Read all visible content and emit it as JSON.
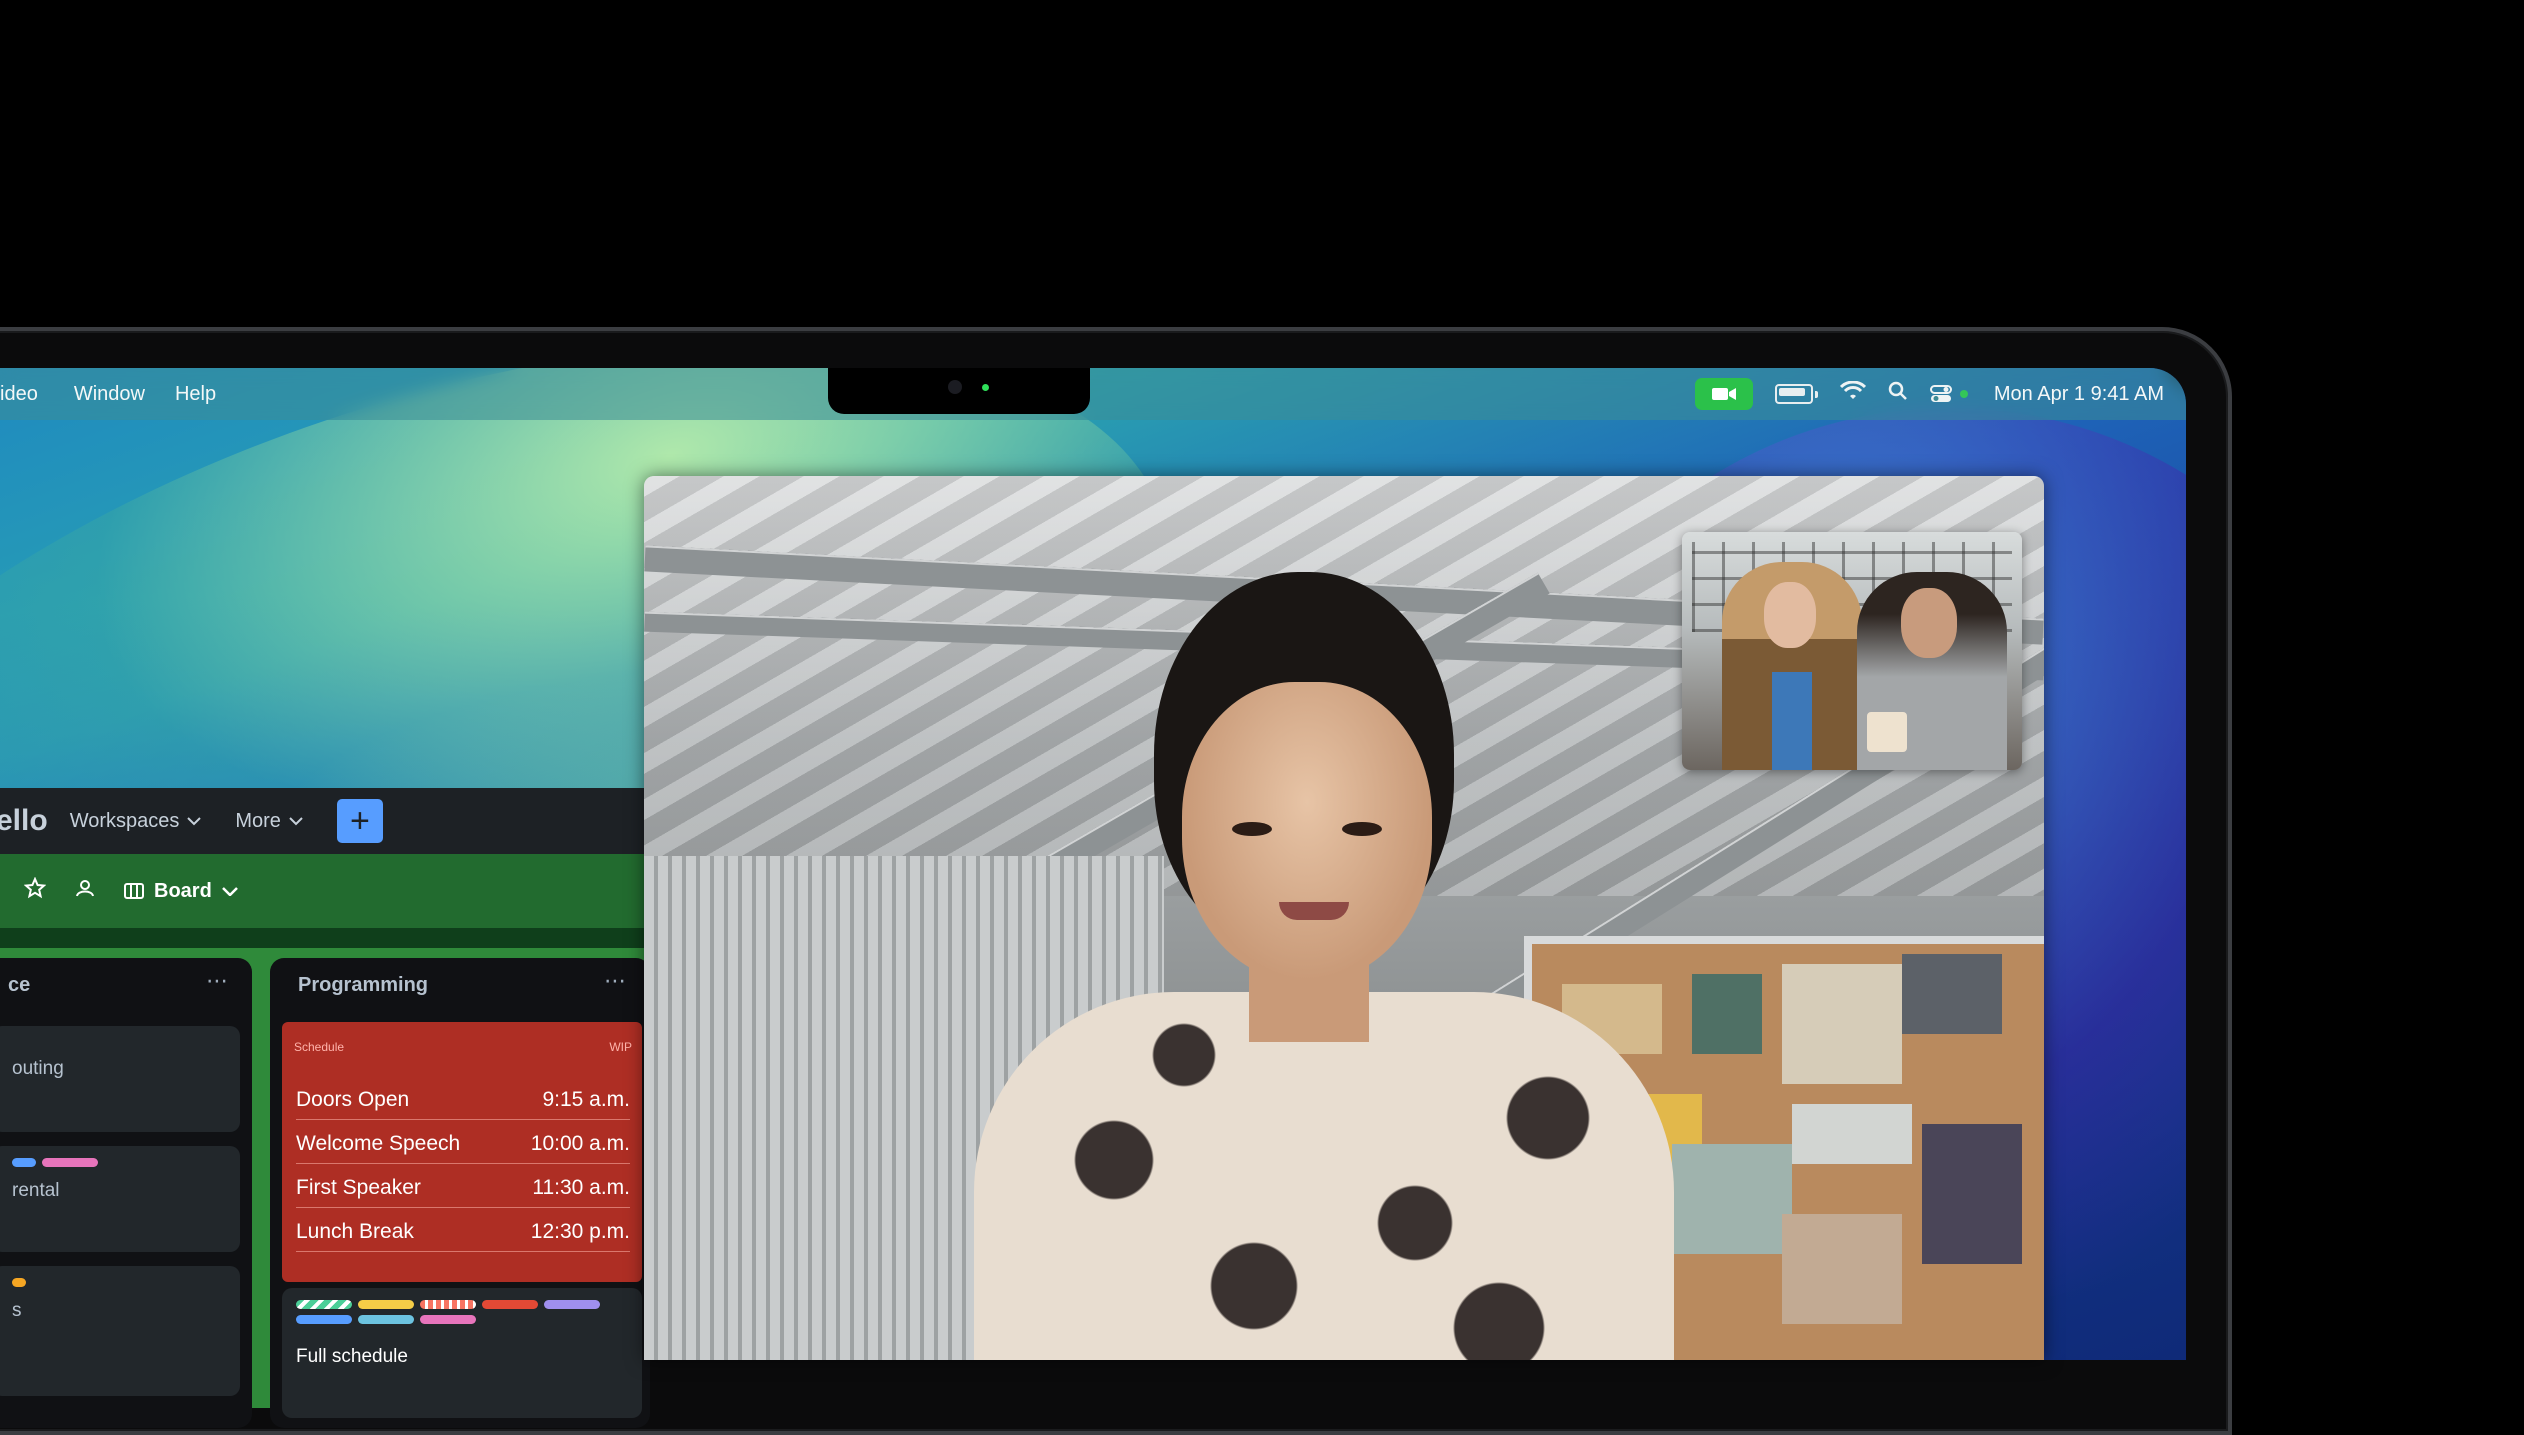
{
  "menubar": {
    "left_items": [
      "ideo",
      "Window",
      "Help"
    ],
    "datetime": "Mon Apr 1  9:41 AM",
    "status_icons": [
      "facetime-video-icon",
      "battery-icon",
      "wifi-icon",
      "search-icon",
      "control-center-icon"
    ]
  },
  "trello": {
    "logo": "ello",
    "nav": {
      "workspaces": "Workspaces",
      "more": "More",
      "create": "+"
    },
    "board_bar": {
      "view_label": "Board"
    },
    "lists": [
      {
        "title": "ce",
        "cards": [
          {
            "text": "outing"
          },
          {
            "text": "rental"
          },
          {
            "text": "s"
          }
        ]
      },
      {
        "title": "Programming",
        "schedule": {
          "header_left": "Schedule",
          "header_right": "WIP",
          "rows": [
            {
              "name": "Doors Open",
              "time": "9:15 a.m."
            },
            {
              "name": "Welcome Speech",
              "time": "10:00 a.m."
            },
            {
              "name": "First Speaker",
              "time": "11:30 a.m."
            },
            {
              "name": "Lunch Break",
              "time": "12:30 p.m."
            }
          ]
        },
        "card2_title": "Full schedule"
      }
    ],
    "colors": {
      "topbar": "#1d2125",
      "boardbar": "#226b2f",
      "schedule_card": "#ae2e24",
      "create_button": "#579dff"
    }
  },
  "facetime": {
    "accent": "#2bc14a"
  }
}
